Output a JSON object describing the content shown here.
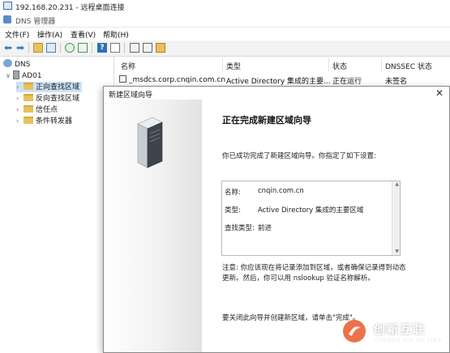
{
  "rdp": {
    "title": "192.168.20.231 - 远程桌面连接"
  },
  "app": {
    "title": "DNS 管理器"
  },
  "menu": [
    "文件(F)",
    "操作(A)",
    "查看(V)",
    "帮助(H)"
  ],
  "toolbar": {
    "icons": [
      "back-arrow-icon",
      "forward-arrow-icon",
      "up-folder-icon",
      "show-tree-icon",
      "refresh-icon",
      "export-icon",
      "help-icon",
      "properties-icon",
      "list-icon",
      "view-icon",
      "new-zone-icon"
    ]
  },
  "tree": {
    "root": "DNS",
    "server": "AD01",
    "items": [
      "正向查找区域",
      "反向查找区域",
      "信任点",
      "条件转发器"
    ]
  },
  "list": {
    "columns": [
      "名称",
      "类型",
      "状态",
      "DNSSEC 状态"
    ],
    "rows": [
      {
        "name": "_msdcs.corp.cnqin.com.cn",
        "type": "Active Directory 集成的主要...",
        "status": "正在运行",
        "dnssec": "未签名"
      }
    ]
  },
  "wizard": {
    "title": "新建区域向导",
    "heading": "正在完成新建区域向导",
    "intro": "你已成功完成了新建区域向导。你指定了如下设置:",
    "summary": [
      {
        "key": "名称:",
        "value": "cnqin.com.cn"
      },
      {
        "key": "类型:",
        "value": "Active Directory 集成的主要区域"
      },
      {
        "key": "查找类型:",
        "value": "前进"
      }
    ],
    "note": "注意: 你应该现在将记录添加到区域，或者确保记录得到动态更新。然后，你可以用 nslookup 验证名称解析。",
    "footer": "要关闭此向导并创建新区域，请单击\"完成\"。"
  },
  "watermark": {
    "text": "创新互联",
    "sub": "CHUANG XIN HU LIAN"
  },
  "colors": {
    "selection": "#cce4f7",
    "folder": "#e8c15f",
    "accent": "#3b78c3"
  }
}
